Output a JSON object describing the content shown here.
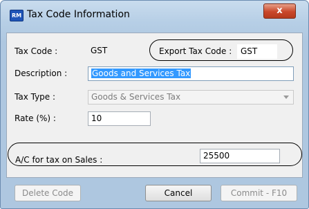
{
  "window": {
    "title": "Tax Code Information",
    "app_icon_text": "RM",
    "close_glyph": "x"
  },
  "form": {
    "tax_code_label": "Tax Code :",
    "tax_code_value": "GST",
    "export_tax_code_label": "Export Tax Code :",
    "export_tax_code_value": "GST",
    "description_label": "Description :",
    "description_value": "Goods and Services Tax",
    "tax_type_label": "Tax Type :",
    "tax_type_value": "Goods & Services Tax",
    "rate_label": "Rate (%) :",
    "rate_value": "10",
    "ac_sales_label": "A/C for tax on Sales :",
    "ac_sales_value": "25500"
  },
  "buttons": {
    "delete_label": "Delete Code",
    "cancel_label": "Cancel",
    "commit_label": "Commit - F10"
  },
  "icons": {
    "app": "app-icon",
    "close": "close-icon",
    "dropdown": "chevron-down-icon"
  }
}
